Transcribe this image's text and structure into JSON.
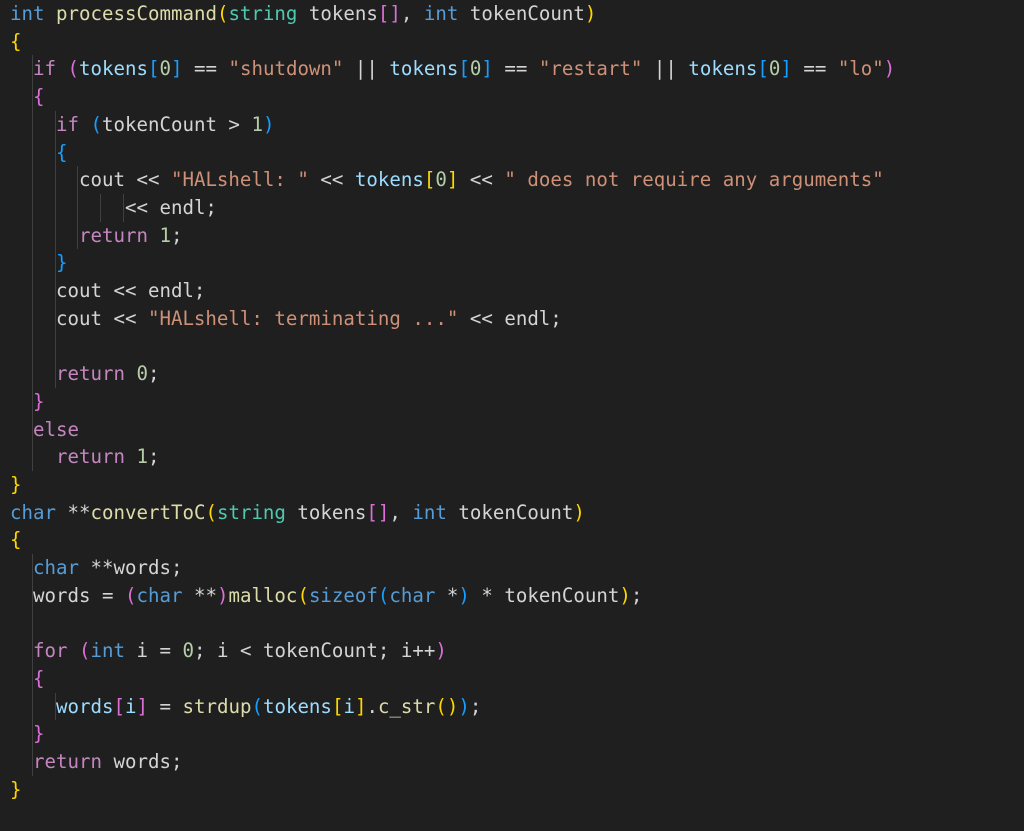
{
  "editor": {
    "language": "cpp",
    "theme": "dark-modern",
    "background_color": "#1f1f1f",
    "foreground_color": "#d4d4d4",
    "font_size_px": 19,
    "line_height_px": 27.7,
    "indent_guide_color": "#404040",
    "bracket_colors": [
      "#ffd700",
      "#da70d6",
      "#179fff"
    ],
    "token_colors": {
      "keyword_control": "#c586c0",
      "type": "#569cd6",
      "class_name": "#4ec9b0",
      "function": "#dcdcaa",
      "string": "#ce9178",
      "number": "#b5cea8",
      "variable": "#9cdcfe",
      "plain": "#d4d4d4"
    }
  },
  "code": {
    "line_count": 30,
    "lines": [
      {
        "n": 1,
        "indent": 0,
        "tokens": [
          {
            "t": "int",
            "c": "t-type"
          },
          {
            "t": " ",
            "c": "t-plain"
          },
          {
            "t": "processCommand",
            "c": "t-fn"
          },
          {
            "t": "(",
            "c": "b0"
          },
          {
            "t": "string",
            "c": "t-class"
          },
          {
            "t": " tokens",
            "c": "t-plain"
          },
          {
            "t": "[]",
            "c": "b1"
          },
          {
            "t": ", ",
            "c": "t-plain"
          },
          {
            "t": "int",
            "c": "t-type"
          },
          {
            "t": " tokenCount",
            "c": "t-plain"
          },
          {
            "t": ")",
            "c": "b0"
          }
        ]
      },
      {
        "n": 2,
        "indent": 0,
        "tokens": [
          {
            "t": "{",
            "c": "b0"
          }
        ]
      },
      {
        "n": 3,
        "indent": 1,
        "tokens": [
          {
            "t": "if",
            "c": "t-kw"
          },
          {
            "t": " ",
            "c": "t-plain"
          },
          {
            "t": "(",
            "c": "b1"
          },
          {
            "t": "tokens",
            "c": "t-var"
          },
          {
            "t": "[",
            "c": "b2"
          },
          {
            "t": "0",
            "c": "t-num"
          },
          {
            "t": "]",
            "c": "b2"
          },
          {
            "t": " == ",
            "c": "t-plain"
          },
          {
            "t": "\"shutdown\"",
            "c": "t-str"
          },
          {
            "t": " || ",
            "c": "t-plain"
          },
          {
            "t": "tokens",
            "c": "t-var"
          },
          {
            "t": "[",
            "c": "b2"
          },
          {
            "t": "0",
            "c": "t-num"
          },
          {
            "t": "]",
            "c": "b2"
          },
          {
            "t": " == ",
            "c": "t-plain"
          },
          {
            "t": "\"restart\"",
            "c": "t-str"
          },
          {
            "t": " || ",
            "c": "t-plain"
          },
          {
            "t": "tokens",
            "c": "t-var"
          },
          {
            "t": "[",
            "c": "b2"
          },
          {
            "t": "0",
            "c": "t-num"
          },
          {
            "t": "]",
            "c": "b2"
          },
          {
            "t": " == ",
            "c": "t-plain"
          },
          {
            "t": "\"lo\"",
            "c": "t-str"
          },
          {
            "t": ")",
            "c": "b1"
          }
        ]
      },
      {
        "n": 4,
        "indent": 1,
        "tokens": [
          {
            "t": "{",
            "c": "b1"
          }
        ]
      },
      {
        "n": 5,
        "indent": 2,
        "tokens": [
          {
            "t": "if",
            "c": "t-kw"
          },
          {
            "t": " ",
            "c": "t-plain"
          },
          {
            "t": "(",
            "c": "b2"
          },
          {
            "t": "tokenCount > ",
            "c": "t-plain"
          },
          {
            "t": "1",
            "c": "t-num"
          },
          {
            "t": ")",
            "c": "b2"
          }
        ]
      },
      {
        "n": 6,
        "indent": 2,
        "tokens": [
          {
            "t": "{",
            "c": "b2"
          }
        ]
      },
      {
        "n": 7,
        "indent": 3,
        "tokens": [
          {
            "t": "cout << ",
            "c": "t-plain"
          },
          {
            "t": "\"HALshell: \"",
            "c": "t-str"
          },
          {
            "t": " << ",
            "c": "t-plain"
          },
          {
            "t": "tokens",
            "c": "t-var"
          },
          {
            "t": "[",
            "c": "b0"
          },
          {
            "t": "0",
            "c": "t-num"
          },
          {
            "t": "]",
            "c": "b0"
          },
          {
            "t": " << ",
            "c": "t-plain"
          },
          {
            "t": "\" does not require any arguments\"",
            "c": "t-str"
          }
        ]
      },
      {
        "n": 8,
        "indent": 5,
        "tokens": [
          {
            "t": "<< endl;",
            "c": "t-plain"
          }
        ]
      },
      {
        "n": 9,
        "indent": 3,
        "tokens": [
          {
            "t": "return",
            "c": "t-kw"
          },
          {
            "t": " ",
            "c": "t-plain"
          },
          {
            "t": "1",
            "c": "t-num"
          },
          {
            "t": ";",
            "c": "t-plain"
          }
        ]
      },
      {
        "n": 10,
        "indent": 2,
        "tokens": [
          {
            "t": "}",
            "c": "b2"
          }
        ]
      },
      {
        "n": 11,
        "indent": 2,
        "tokens": [
          {
            "t": "cout << endl;",
            "c": "t-plain"
          }
        ]
      },
      {
        "n": 12,
        "indent": 2,
        "tokens": [
          {
            "t": "cout << ",
            "c": "t-plain"
          },
          {
            "t": "\"HALshell: terminating ...\"",
            "c": "t-str"
          },
          {
            "t": " << endl;",
            "c": "t-plain"
          }
        ]
      },
      {
        "n": 13,
        "indent": 0,
        "tokens": []
      },
      {
        "n": 14,
        "indent": 2,
        "tokens": [
          {
            "t": "return",
            "c": "t-kw"
          },
          {
            "t": " ",
            "c": "t-plain"
          },
          {
            "t": "0",
            "c": "t-num"
          },
          {
            "t": ";",
            "c": "t-plain"
          }
        ]
      },
      {
        "n": 15,
        "indent": 1,
        "tokens": [
          {
            "t": "}",
            "c": "b1"
          }
        ]
      },
      {
        "n": 16,
        "indent": 1,
        "tokens": [
          {
            "t": "else",
            "c": "t-kw"
          }
        ]
      },
      {
        "n": 17,
        "indent": 2,
        "tokens": [
          {
            "t": "return",
            "c": "t-kw"
          },
          {
            "t": " ",
            "c": "t-plain"
          },
          {
            "t": "1",
            "c": "t-num"
          },
          {
            "t": ";",
            "c": "t-plain"
          }
        ]
      },
      {
        "n": 18,
        "indent": 0,
        "tokens": [
          {
            "t": "}",
            "c": "b0"
          }
        ]
      },
      {
        "n": 19,
        "indent": 0,
        "tokens": [
          {
            "t": "char",
            "c": "t-type"
          },
          {
            "t": " **",
            "c": "t-plain"
          },
          {
            "t": "convertToC",
            "c": "t-fn"
          },
          {
            "t": "(",
            "c": "b0"
          },
          {
            "t": "string",
            "c": "t-class"
          },
          {
            "t": " tokens",
            "c": "t-plain"
          },
          {
            "t": "[]",
            "c": "b1"
          },
          {
            "t": ", ",
            "c": "t-plain"
          },
          {
            "t": "int",
            "c": "t-type"
          },
          {
            "t": " tokenCount",
            "c": "t-plain"
          },
          {
            "t": ")",
            "c": "b0"
          }
        ]
      },
      {
        "n": 20,
        "indent": 0,
        "tokens": [
          {
            "t": "{",
            "c": "b0"
          }
        ]
      },
      {
        "n": 21,
        "indent": 1,
        "tokens": [
          {
            "t": "char",
            "c": "t-type"
          },
          {
            "t": " **words;",
            "c": "t-plain"
          }
        ]
      },
      {
        "n": 22,
        "indent": 1,
        "tokens": [
          {
            "t": "words = ",
            "c": "t-plain"
          },
          {
            "t": "(",
            "c": "b1"
          },
          {
            "t": "char",
            "c": "t-type"
          },
          {
            "t": " **",
            "c": "t-plain"
          },
          {
            "t": ")",
            "c": "b1"
          },
          {
            "t": "malloc",
            "c": "t-fn"
          },
          {
            "t": "(",
            "c": "b0"
          },
          {
            "t": "sizeof",
            "c": "t-type"
          },
          {
            "t": "(",
            "c": "b2"
          },
          {
            "t": "char",
            "c": "t-type"
          },
          {
            "t": " *",
            "c": "t-plain"
          },
          {
            "t": ")",
            "c": "b2"
          },
          {
            "t": " * tokenCount",
            "c": "t-plain"
          },
          {
            "t": ")",
            "c": "b0"
          },
          {
            "t": ";",
            "c": "t-plain"
          }
        ]
      },
      {
        "n": 23,
        "indent": 0,
        "tokens": []
      },
      {
        "n": 24,
        "indent": 1,
        "tokens": [
          {
            "t": "for",
            "c": "t-kw"
          },
          {
            "t": " ",
            "c": "t-plain"
          },
          {
            "t": "(",
            "c": "b1"
          },
          {
            "t": "int",
            "c": "t-type"
          },
          {
            "t": " i = ",
            "c": "t-plain"
          },
          {
            "t": "0",
            "c": "t-num"
          },
          {
            "t": "; i < tokenCount; i++",
            "c": "t-plain"
          },
          {
            "t": ")",
            "c": "b1"
          }
        ]
      },
      {
        "n": 25,
        "indent": 1,
        "tokens": [
          {
            "t": "{",
            "c": "b1"
          }
        ]
      },
      {
        "n": 26,
        "indent": 2,
        "tokens": [
          {
            "t": "words",
            "c": "t-var"
          },
          {
            "t": "[",
            "c": "b1"
          },
          {
            "t": "i",
            "c": "t-var"
          },
          {
            "t": "]",
            "c": "b1"
          },
          {
            "t": " = ",
            "c": "t-plain"
          },
          {
            "t": "strdup",
            "c": "t-fn"
          },
          {
            "t": "(",
            "c": "b2"
          },
          {
            "t": "tokens",
            "c": "t-var"
          },
          {
            "t": "[",
            "c": "b0"
          },
          {
            "t": "i",
            "c": "t-var"
          },
          {
            "t": "]",
            "c": "b0"
          },
          {
            "t": ".",
            "c": "t-plain"
          },
          {
            "t": "c_str",
            "c": "t-fn"
          },
          {
            "t": "(",
            "c": "b0"
          },
          {
            "t": ")",
            "c": "b0"
          },
          {
            "t": ")",
            "c": "b2"
          },
          {
            "t": ";",
            "c": "t-plain"
          }
        ]
      },
      {
        "n": 27,
        "indent": 1,
        "tokens": [
          {
            "t": "}",
            "c": "b1"
          }
        ]
      },
      {
        "n": 28,
        "indent": 1,
        "tokens": [
          {
            "t": "return",
            "c": "t-kw"
          },
          {
            "t": " words;",
            "c": "t-plain"
          }
        ]
      },
      {
        "n": 29,
        "indent": 0,
        "tokens": [
          {
            "t": "}",
            "c": "b0"
          }
        ]
      },
      {
        "n": 30,
        "indent": 0,
        "tokens": []
      }
    ]
  },
  "indent_guides": [
    {
      "line_start": 3,
      "line_end": 17,
      "level": 1
    },
    {
      "line_start": 5,
      "line_end": 14,
      "level": 2
    },
    {
      "line_start": 7,
      "line_end": 9,
      "level": 3
    },
    {
      "line_start": 8,
      "line_end": 8,
      "level": 4
    },
    {
      "line_start": 8,
      "line_end": 8,
      "level": 5
    },
    {
      "line_start": 21,
      "line_end": 28,
      "level": 1
    },
    {
      "line_start": 26,
      "line_end": 26,
      "level": 2
    }
  ]
}
